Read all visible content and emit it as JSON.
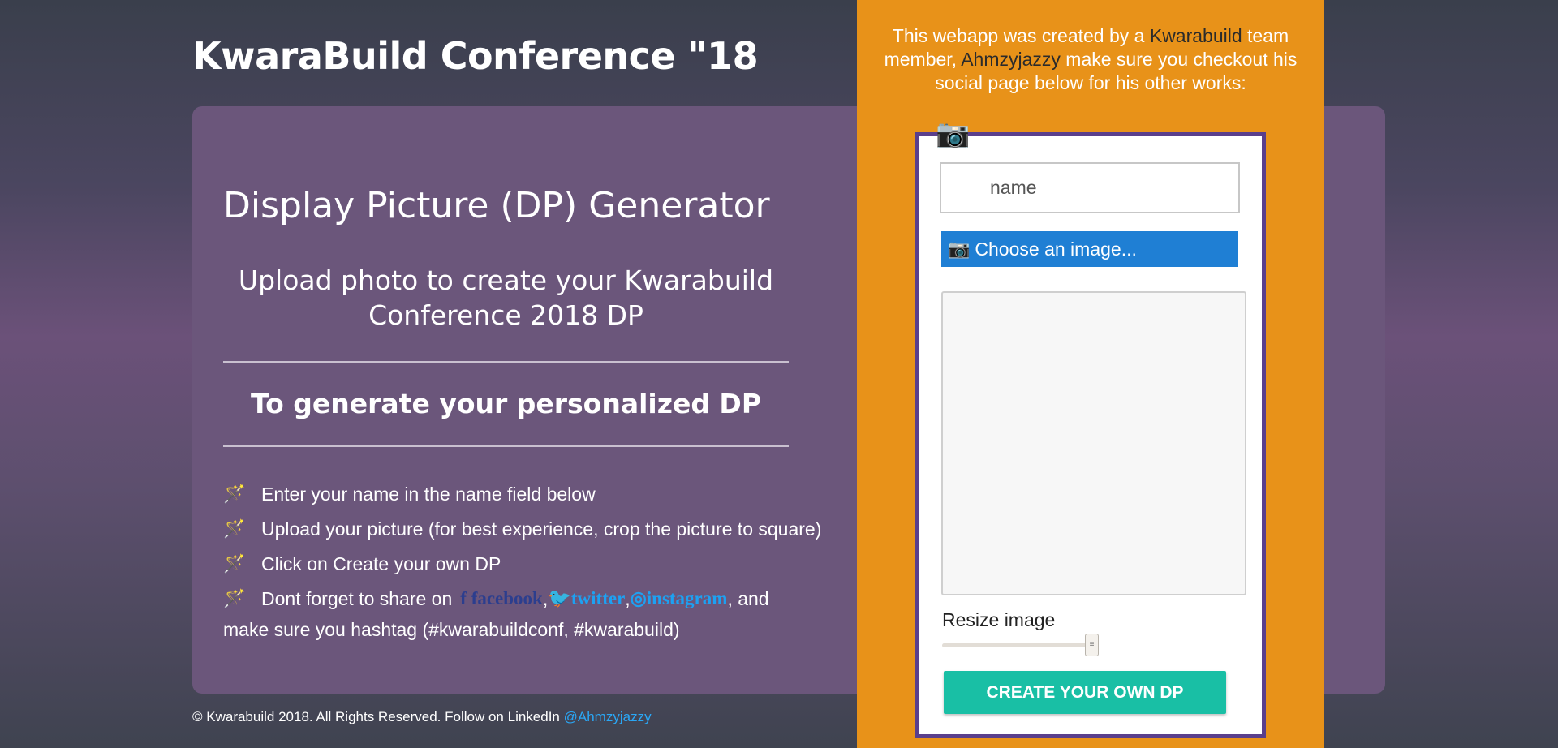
{
  "header": {
    "title": "KwaraBuild Conference \"18"
  },
  "main": {
    "heading": "Display Picture (DP) Generator",
    "subheading": "Upload photo to create your Kwarabuild Conference 2018 DP",
    "generate_heading": "To generate your personalized DP",
    "steps": [
      "Enter your name in the name field below",
      "Upload your picture (for best experience, crop the picture to square)",
      "Click on Create your own DP"
    ],
    "share": {
      "prefix": "Dont forget to share on",
      "facebook": "facebook",
      "twitter": "twitter",
      "instagram": "instagram",
      "comma": ",",
      "suffix": ", and",
      "hashtag_line": "make sure you hashtag (#kwarabuildconf, #kwarabuild)"
    },
    "step_icon": "magic-wand-icon"
  },
  "footer": {
    "text": "© Kwarabuild 2018. All Rights Reserved. Follow on LinkedIn",
    "link": "@Ahmzyjazzy"
  },
  "credit": {
    "part1": "This webapp was created by a",
    "org": "Kwarabuild",
    "part2": "team member,",
    "author": "Ahmzyjazzy",
    "part3": "make sure you checkout his social page below for his other works:"
  },
  "form": {
    "name_placeholder": "name",
    "choose_label": "Choose an image...",
    "resize_label": "Resize image",
    "slider_value": 0.9,
    "create_label": "CREATE YOUR OWN DP",
    "camera_icon": "camera-icon"
  },
  "colors": {
    "card": "#6b567b",
    "orange": "#e89219",
    "choose": "#1f7fd4",
    "create": "#19bfa5",
    "link": "#2aa7f5"
  }
}
